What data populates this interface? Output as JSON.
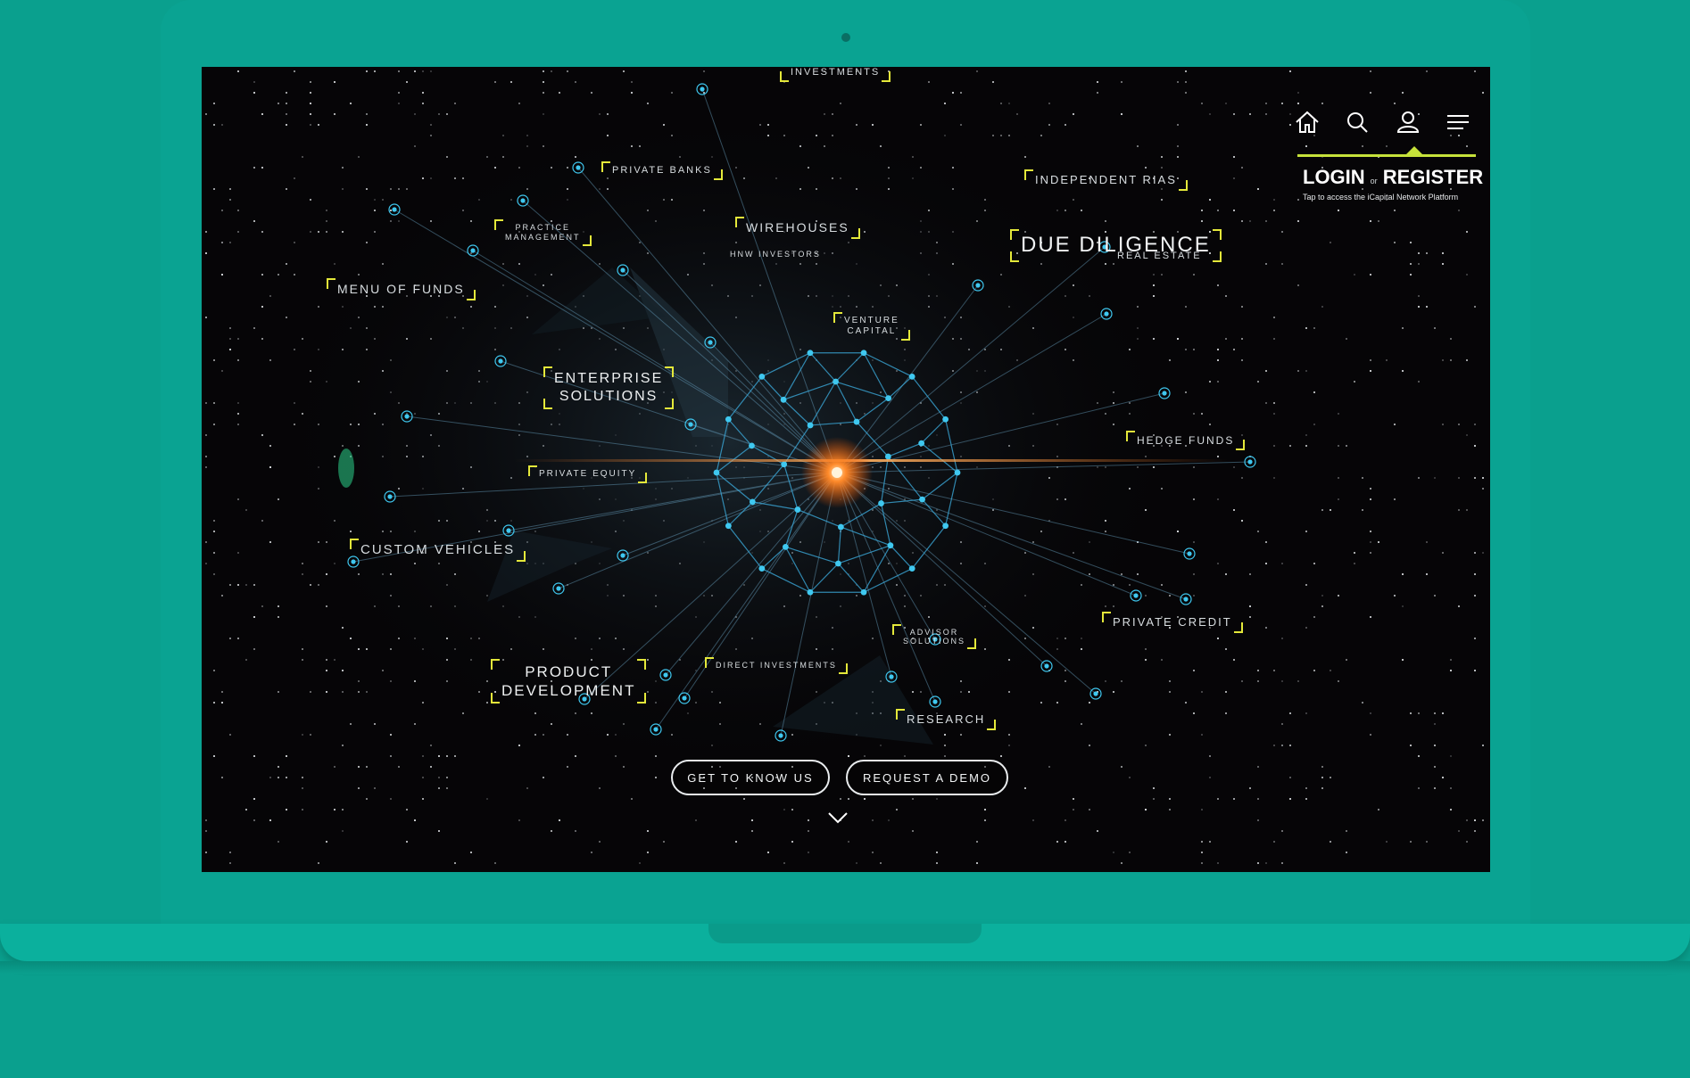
{
  "nav": {
    "icons": [
      "home-icon",
      "search-icon",
      "user-icon",
      "menu-icon"
    ],
    "login_label": "LOGIN",
    "or_label": "or",
    "register_label": "REGISTER",
    "login_subtitle": "Tap to access the iCapital Network Platform"
  },
  "network": {
    "labels": {
      "investments": "INVESTMENTS",
      "private_banks": "PRIVATE BANKS",
      "practice_management_1": "PRACTICE",
      "practice_management_2": "MANAGEMENT",
      "wirehouses": "WIREHOUSES",
      "hnw_investors": "HNW INVESTORS",
      "independent_rias": "INDEPENDENT RIAS",
      "due_diligence": "DUE DILIGENCE",
      "real_estate": "REAL ESTATE",
      "menu_of_funds": "MENU OF FUNDS",
      "venture_capital_1": "VENTURE",
      "venture_capital_2": "CAPITAL",
      "enterprise_solutions_1": "ENTERPRISE",
      "enterprise_solutions_2": "SOLUTIONS",
      "hedge_funds": "HEDGE FUNDS",
      "private_equity": "PRIVATE EQUITY",
      "custom_vehicles": "CUSTOM VEHICLES",
      "private_credit": "PRIVATE CREDIT",
      "advisor_solutions_1": "ADVISOR",
      "advisor_solutions_2": "SOLUTIONS",
      "direct_investments": "DIRECT INVESTMENTS",
      "product_development_1": "PRODUCT",
      "product_development_2": "DEVELOPMENT",
      "research": "RESEARCH"
    }
  },
  "cta": {
    "get_to_know_us": "GET TO KNOW US",
    "request_demo": "REQUEST A DEMO"
  },
  "colors": {
    "device": "#0aa392",
    "screen_bg": "#060507",
    "accent_yellow": "#e4e83a",
    "node_blue": "#3fc8f0",
    "core_orange": "#ff7a20",
    "login_underline": "#c6e23a"
  }
}
